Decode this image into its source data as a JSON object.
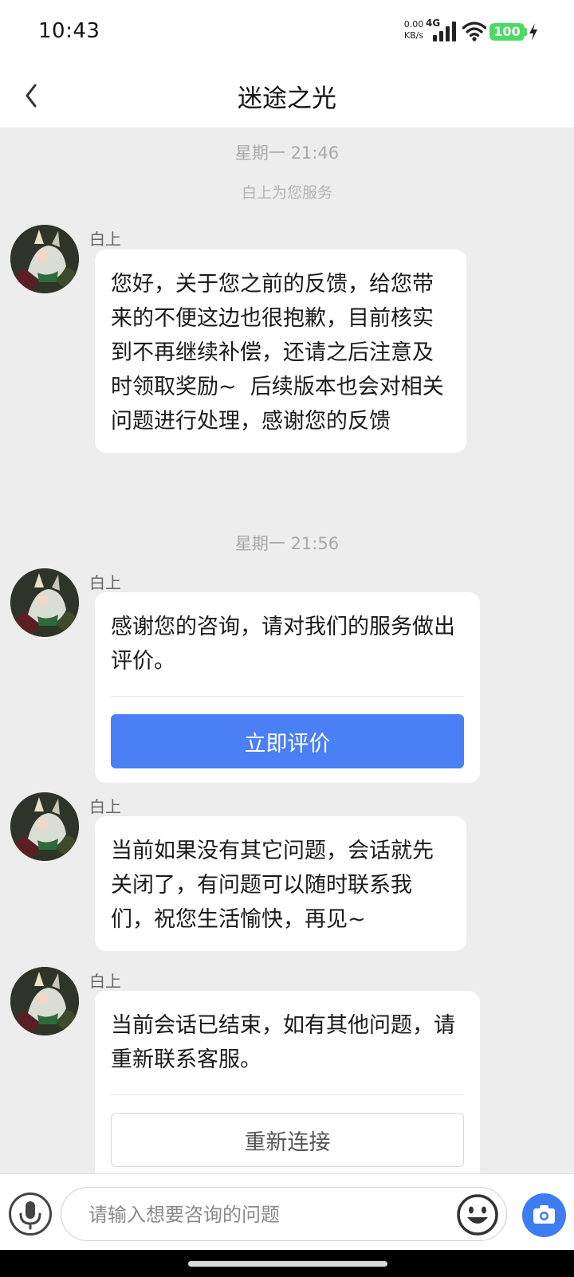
{
  "status_bar": {
    "time": "10:43",
    "net_speed_value": "0.00",
    "net_speed_unit": "KB/s",
    "network_type": "4G",
    "battery_level": "100"
  },
  "header": {
    "title": "迷途之光",
    "back_icon": "chevron-left-icon"
  },
  "chat": {
    "sessions": [
      {
        "time": "星期一 21:46",
        "system_note": "白上为您服务"
      },
      {
        "time": "星期一 21:56"
      }
    ],
    "messages": [
      {
        "sender": "白上",
        "text": "您好，关于您之前的反馈，给您带来的不便这边也很抱歉，目前核实到不再继续补偿，还请之后注意及时领取奖励~  后续版本也会对相关问题进行处理，感谢您的反馈"
      },
      {
        "sender": "白上",
        "text": "感谢您的咨询，请对我们的服务做出评价。",
        "button_label": "立即评价"
      },
      {
        "sender": "白上",
        "text": "当前如果没有其它问题，会话就先关闭了，有问题可以随时联系我们，祝您生活愉快，再见~"
      },
      {
        "sender": "白上",
        "text": "当前会话已结束，如有其他问题，请重新联系客服。",
        "button_label": "重新连接"
      }
    ]
  },
  "input_bar": {
    "placeholder": "请输入想要咨询的问题",
    "value": "",
    "voice_icon": "microphone-icon",
    "emoji_icon": "emoji-icon",
    "camera_icon": "camera-icon"
  },
  "colors": {
    "accent": "#4a7ff5",
    "camera_button": "#3e7cf3",
    "chat_background": "#ededed",
    "battery": "#4cd964"
  }
}
